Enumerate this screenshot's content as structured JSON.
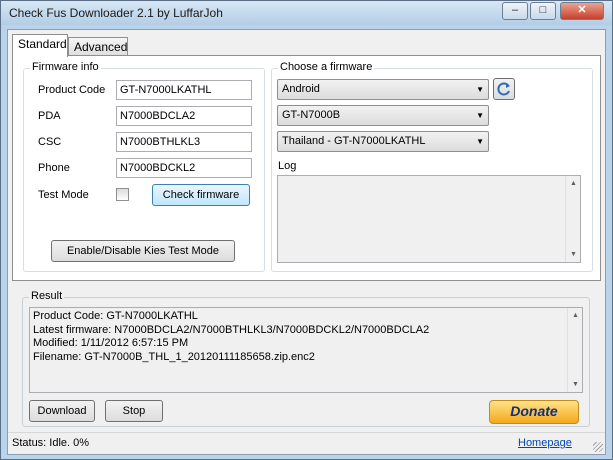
{
  "window": {
    "title": "Check Fus Downloader 2.1 by LuffarJoh"
  },
  "caption_buttons": {
    "minimize": "–",
    "maximize": "□",
    "close": "✕"
  },
  "tabs": [
    {
      "label": "Standard"
    },
    {
      "label": "Advanced"
    }
  ],
  "firmware_info": {
    "legend": "Firmware info",
    "product_code_label": "Product Code",
    "product_code_value": "GT-N7000LKATHL",
    "pda_label": "PDA",
    "pda_value": "N7000BDCLA2",
    "csc_label": "CSC",
    "csc_value": "N7000BTHLKL3",
    "phone_label": "Phone",
    "phone_value": "N7000BDCKL2",
    "test_mode_label": "Test Mode",
    "check_firmware_label": "Check firmware",
    "kies_label": "Enable/Disable Kies Test Mode"
  },
  "choose_firmware": {
    "legend": "Choose a firmware",
    "os_value": "Android",
    "model_value": "GT-N7000B",
    "region_value": "Thailand - GT-N7000LKATHL",
    "log_label": "Log"
  },
  "result": {
    "legend": "Result",
    "lines": [
      "Product Code: GT-N7000LKATHL",
      "Latest firmware: N7000BDCLA2/N7000BTHLKL3/N7000BDCKL2/N7000BDCLA2",
      "Modified: 1/11/2012 6:57:15 PM",
      "Filename: GT-N7000B_THL_1_20120111185658.zip.enc2"
    ],
    "download_label": "Download",
    "stop_label": "Stop",
    "donate_label": "Donate"
  },
  "statusbar": {
    "status": "Status: Idle.  0%",
    "homepage": "Homepage"
  }
}
